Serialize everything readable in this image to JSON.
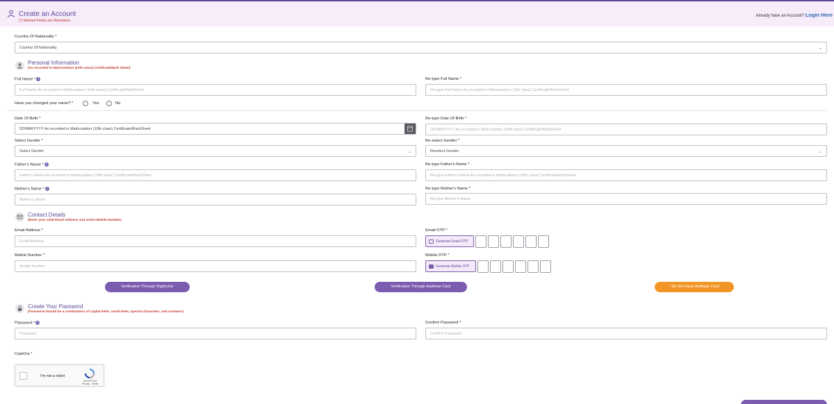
{
  "header": {
    "title": "Create an Account",
    "subtitle": "(*) Marked Fields are Mandatory",
    "already": "Already have an Account?",
    "login": "Login Here"
  },
  "nationality": {
    "label": "Country Of Nationality *",
    "value": "Country Of Nationality"
  },
  "personal": {
    "title": "Personal Information",
    "subtitle": "(As recorded in Matriculation (10th class) Certificate/Mark Sheet)",
    "full_name_label": "Full Name *",
    "full_name_placeholder": "Full Name As recorded in Matriculation (10th class) Certificate/MarkSheet",
    "retype_full_name_label": "Re-type Full Name *",
    "retype_full_name_placeholder": "Re-type Full Name As recorded in Matriculation (10th class) Certificate/MarkSheet",
    "changed_name_question": "Have you changed your name? *",
    "yes": "Yes",
    "no": "No",
    "dob_label": "Date Of Birth *",
    "dob_placeholder": "DD/MM/YYYY As recorded in Matriculation (10th class) Certificate/MarkSheet",
    "retype_dob_label": "Re-type Date Of Birth *",
    "retype_dob_placeholder": "DD/MM/YYYY As recorded in Matriculation (10th class) Certificate/MarkSheet",
    "gender_label": "Select Gender *",
    "gender_value": "Select Gender",
    "reselect_gender_label": "Re-select Gender *",
    "reselect_gender_value": "Reselect Gender",
    "father_label": "Father's Name *",
    "father_placeholder": "Father's Name As recorded in Matriculation (10th class) Certificate/MarkSheet",
    "retype_father_label": "Re-type Father's Name *",
    "retype_father_placeholder": "Re-type Father's Name As recorded in Matriculation (10th class) Certificate/MarkSheet",
    "mother_label": "Mother's Name *",
    "mother_placeholder": "Mother's Name",
    "retype_mother_label": "Re-type Mother's Name *",
    "retype_mother_placeholder": "Re-type Mother's Name"
  },
  "contact": {
    "title": "Contact Details",
    "subtitle": "(Enter your valid Email Address and active Mobile Number)",
    "email_label": "Email Address *",
    "email_placeholder": "Email Address",
    "email_otp_label": "Email OTP *",
    "generate_email_otp": "Generate Email OTP",
    "mobile_label": "Mobile Number *",
    "mobile_placeholder": "Mobile Number",
    "mobile_otp_label": "Mobile OTP *",
    "generate_mobile_otp": "Generate Mobile OTP"
  },
  "verification": {
    "digilocker": "Verification Through Digilocker",
    "aadhaar": "Verification Through Aadhaar Card",
    "no_aadhaar": "I Do Not Have Aadhaar Card"
  },
  "password": {
    "title": "Create Your Password",
    "subtitle": "(Password should be a combination of capital letter, small letter, special characters, and numbers)",
    "password_label": "Password *",
    "password_placeholder": "Password",
    "confirm_label": "Confirm Password *",
    "confirm_placeholder": "Confirm Password"
  },
  "captcha": {
    "label": "Captcha *",
    "robot_text": "I'm not a robot",
    "brand": "reCAPTCHA",
    "links": "Privacy - Terms"
  },
  "colors": {
    "accent": "#5e4a99",
    "button_purple": "#7b5cb0",
    "button_orange": "#f19626",
    "mandatory_red": "#c0392b"
  }
}
